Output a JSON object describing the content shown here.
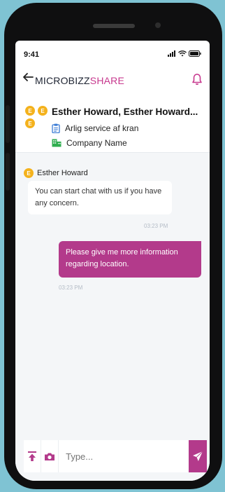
{
  "status": {
    "time": "9:41"
  },
  "appbar": {
    "brand_part1": "MICROBIZZ",
    "brand_part2": "SHARE"
  },
  "chat_header": {
    "avatars": [
      "E",
      "E",
      "E"
    ],
    "title": "Esther Howard, Esther Howard...",
    "service": "Arlig service af kran",
    "company": "Company Name"
  },
  "messages": [
    {
      "direction": "in",
      "sender_initial": "E",
      "sender": "Esther Howard",
      "text": "You can start chat with us if you have any concern.",
      "time": "03:23 PM"
    },
    {
      "direction": "out",
      "text": "Please give me more information regarding location.",
      "time": "03:23 PM"
    }
  ],
  "composer": {
    "placeholder": "Type..."
  },
  "colors": {
    "accent": "#b33a8b",
    "avatar": "#f4b21d",
    "background": "#7fc3d3",
    "service_icon": "#3a7bd5",
    "company_icon": "#2fae4f"
  },
  "icons": {
    "back": "arrow-left-icon",
    "bell": "bell-icon",
    "upload": "upload-icon",
    "camera": "camera-icon",
    "send": "send-icon"
  }
}
